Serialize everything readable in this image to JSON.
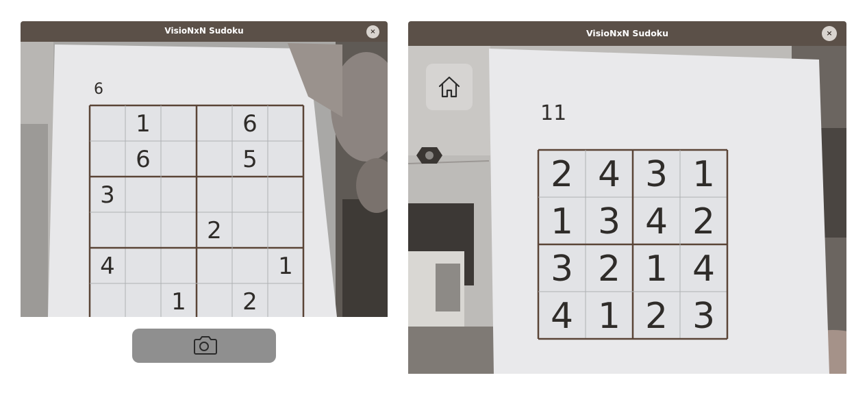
{
  "windows": [
    {
      "title": "VisioNxN Sudoku",
      "close_label": "×"
    },
    {
      "title": "VisioNxN Sudoku",
      "close_label": "×"
    }
  ],
  "left_puzzle": {
    "number": "6",
    "rows": [
      [
        "",
        "1",
        "",
        "",
        "6",
        ""
      ],
      [
        "",
        "6",
        "",
        "",
        "5",
        ""
      ],
      [
        "3",
        "",
        "",
        "",
        "",
        ""
      ],
      [
        "",
        "",
        "",
        "2",
        "",
        ""
      ],
      [
        "4",
        "",
        "",
        "",
        "",
        "1"
      ],
      [
        "",
        "",
        "1",
        "",
        "2",
        ""
      ]
    ]
  },
  "right_puzzle": {
    "number": "11",
    "rows": [
      [
        "2",
        "4",
        "3",
        "1"
      ],
      [
        "1",
        "3",
        "4",
        "2"
      ],
      [
        "3",
        "2",
        "1",
        "4"
      ],
      [
        "4",
        "1",
        "2",
        "3"
      ]
    ]
  },
  "buttons": {
    "capture_icon": "camera-icon",
    "home_icon": "home-icon"
  },
  "colors": {
    "titlebar": "#5b5048",
    "paper": "#e6e6e8",
    "ink": "#2f2c29",
    "grid_line": "#5a4436",
    "capture_button": "#8f8f8f",
    "home_button": "#d6d4d2"
  }
}
